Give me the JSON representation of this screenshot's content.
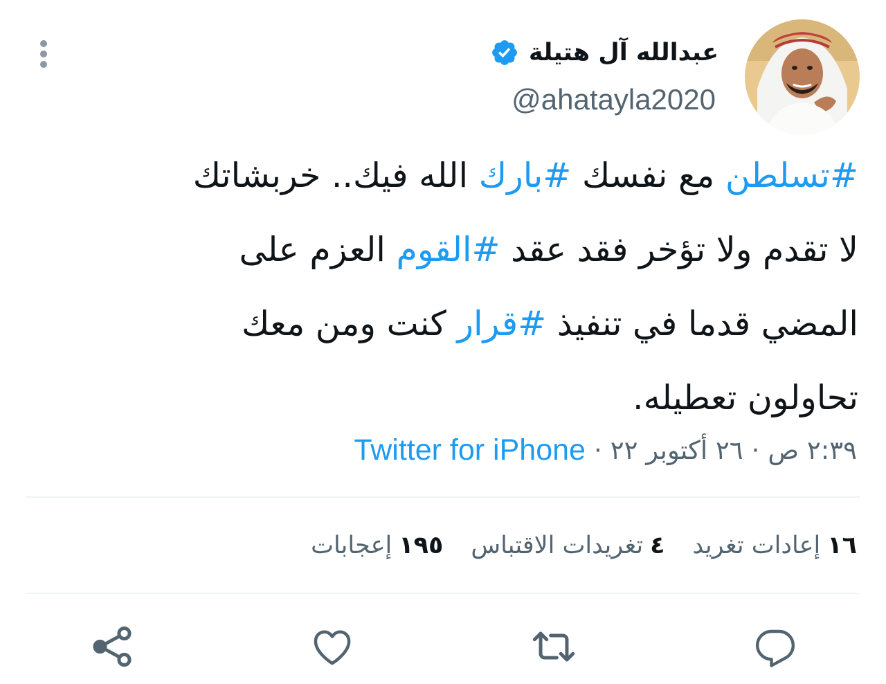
{
  "user": {
    "display_name": "عبدالله آل هتيلة",
    "handle": "@ahatayla2020",
    "verified": true,
    "verified_color": "#1d9bf0"
  },
  "tweet": {
    "lines": [
      [
        {
          "text": "#تسلطن",
          "hashtag": true
        },
        {
          "text": " مع نفسك ",
          "hashtag": false
        },
        {
          "text": "#بارك",
          "hashtag": true
        },
        {
          "text": " الله فيك.. خربشاتك",
          "hashtag": false
        }
      ],
      [
        {
          "text": "لا تقدم ولا تؤخر فقد عقد ",
          "hashtag": false
        },
        {
          "text": "#القوم",
          "hashtag": true
        },
        {
          "text": " العزم على",
          "hashtag": false
        }
      ],
      [
        {
          "text": "المضي قدما في تنفيذ ",
          "hashtag": false
        },
        {
          "text": "#قرار",
          "hashtag": true
        },
        {
          "text": " كنت ومن معك",
          "hashtag": false
        }
      ],
      [
        {
          "text": "تحاولون تعطيله.",
          "hashtag": false
        }
      ]
    ]
  },
  "meta": {
    "time": "٢:٣٩ ص",
    "date": "٢٦ أكتوبر ٢٢",
    "separator": "·",
    "source": "Twitter for iPhone"
  },
  "stats": {
    "retweets": {
      "count": "١٦",
      "label": "إعادات تغريد"
    },
    "quotes": {
      "count": "٤",
      "label": "تغريدات الاقتباس"
    },
    "likes": {
      "count": "١٩٥",
      "label": "إعجابات"
    }
  },
  "actions": {
    "icons": [
      "reply-icon",
      "retweet-icon",
      "like-icon",
      "share-icon"
    ]
  },
  "colors": {
    "accent": "#1d9bf0",
    "text_primary": "#0f1419",
    "text_secondary": "#536471",
    "divider": "#eff3f4"
  }
}
